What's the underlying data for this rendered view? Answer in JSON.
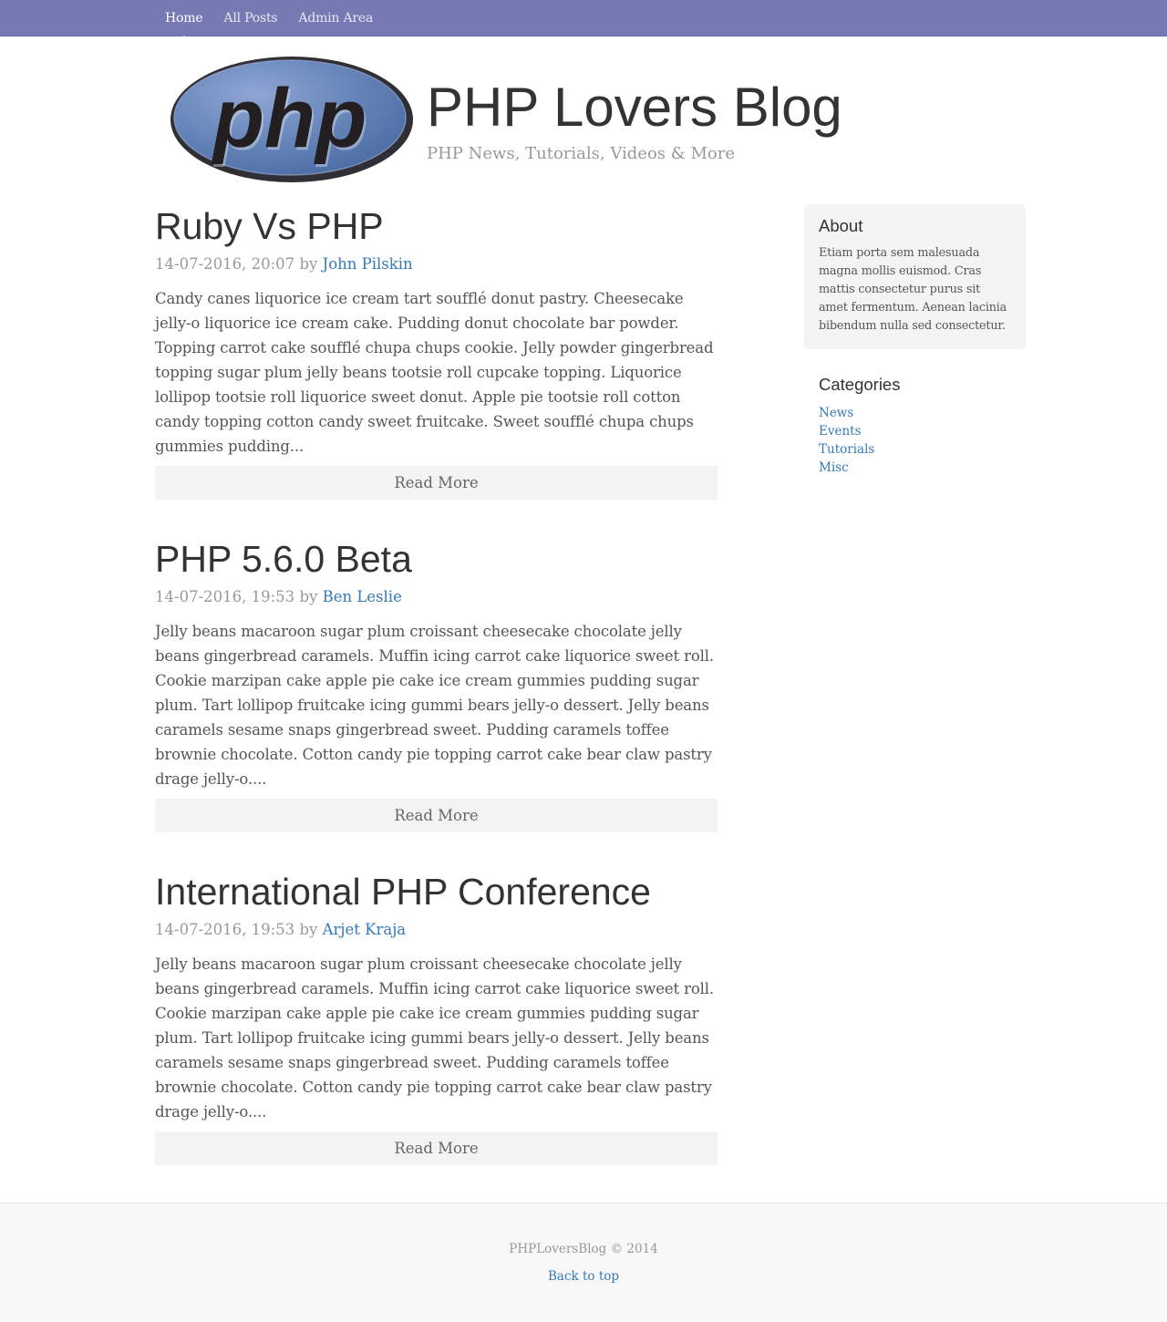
{
  "nav": {
    "items": [
      {
        "label": "Home"
      },
      {
        "label": "All Posts"
      },
      {
        "label": "Admin Area"
      }
    ]
  },
  "header": {
    "logo_text": "php",
    "title": "PHP Lovers Blog",
    "tagline": "PHP News, Tutorials, Videos & More"
  },
  "posts": [
    {
      "title": "Ruby Vs PHP",
      "date": "14-07-2016, 20:07",
      "by": "by",
      "author": "John Pilskin",
      "body": "Candy canes liquorice ice cream tart soufflé donut pastry. Cheesecake jelly-o liquorice ice cream cake. Pudding donut chocolate bar powder. Topping carrot cake soufflé chupa chups cookie. Jelly powder gingerbread topping sugar plum jelly beans tootsie roll cupcake topping. Liquorice lollipop tootsie roll liquorice sweet donut. Apple pie tootsie roll cotton candy topping cotton candy sweet fruitcake. Sweet soufflé chupa chups gummies pudding...",
      "read_more": "Read More"
    },
    {
      "title": "PHP 5.6.0 Beta",
      "date": "14-07-2016, 19:53",
      "by": "by",
      "author": "Ben Leslie",
      "body": "Jelly beans macaroon sugar plum croissant cheesecake chocolate jelly beans gingerbread caramels. Muffin icing carrot cake liquorice sweet roll. Cookie marzipan cake apple pie cake ice cream gummies pudding sugar plum. Tart lollipop fruitcake icing gummi bears jelly-o dessert. Jelly beans caramels sesame snaps gingerbread sweet. Pudding caramels toffee brownie chocolate. Cotton candy pie topping carrot cake bear claw pastry drage jelly-o....",
      "read_more": "Read More"
    },
    {
      "title": "International PHP Conference",
      "date": "14-07-2016, 19:53",
      "by": "by",
      "author": "Arjet Kraja",
      "body": "Jelly beans macaroon sugar plum croissant cheesecake chocolate jelly beans gingerbread caramels. Muffin icing carrot cake liquorice sweet roll. Cookie marzipan cake apple pie cake ice cream gummies pudding sugar plum. Tart lollipop fruitcake icing gummi bears jelly-o dessert. Jelly beans caramels sesame snaps gingerbread sweet. Pudding caramels toffee brownie chocolate. Cotton candy pie topping carrot cake bear claw pastry drage jelly-o....",
      "read_more": "Read More"
    }
  ],
  "sidebar": {
    "about": {
      "heading": "About",
      "text": "Etiam porta sem malesuada magna mollis euismod. Cras mattis consectetur purus sit amet fermentum. Aenean lacinia bibendum nulla sed consectetur."
    },
    "categories": {
      "heading": "Categories",
      "items": [
        "News",
        "Events",
        "Tutorials",
        "Misc"
      ]
    }
  },
  "footer": {
    "copyright": "PHPLoversBlog © 2014",
    "back_to_top": "Back to top"
  },
  "colors": {
    "navbar": "#7779b3",
    "link": "#337ab7",
    "logo_fill": "#6181b6",
    "logo_border": "#2f2f35",
    "logo_text": "#231f20"
  }
}
